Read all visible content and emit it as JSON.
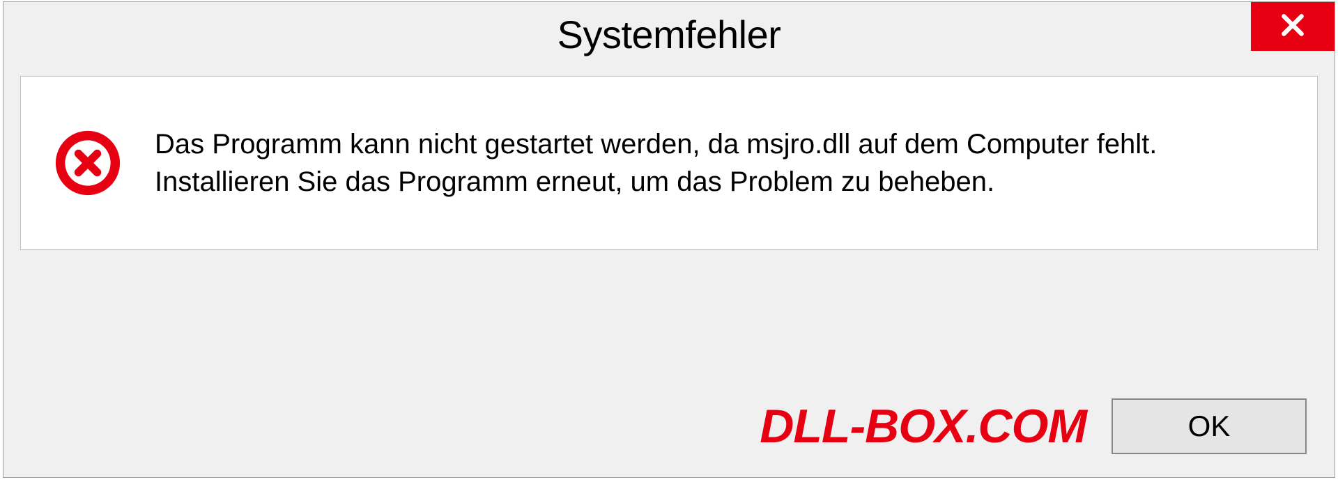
{
  "dialog": {
    "title": "Systemfehler",
    "message": "Das Programm kann nicht gestartet werden, da msjro.dll auf dem Computer fehlt. Installieren Sie das Programm erneut, um das Problem zu beheben.",
    "ok_label": "OK"
  },
  "watermark": "DLL-BOX.COM"
}
